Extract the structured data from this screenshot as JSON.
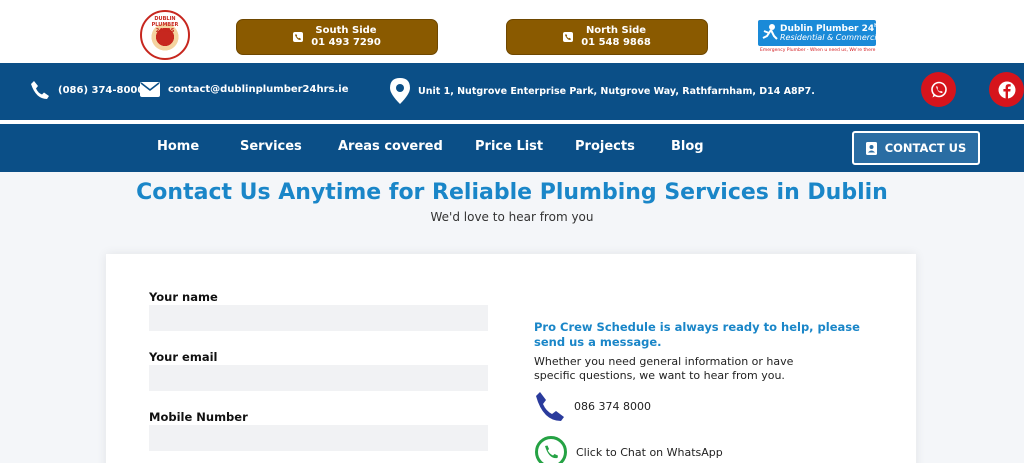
{
  "header": {
    "logo_ring_text": "DUBLIN PLUMBER 24HRS",
    "branches": [
      {
        "name": "South Side",
        "phone": "01 493 7290"
      },
      {
        "name": "North Side",
        "phone": "01 548 9868"
      }
    ],
    "brand": {
      "line1": "Dublin Plumber 24",
      "line1_sup": "hrs",
      "line2": "Residential & Commercial",
      "tagline": "Emergency Plumber - When u need us, We're there"
    }
  },
  "infobar": {
    "phone": "(086) 374-8000",
    "email": "contact@dublinplumber24hrs.ie",
    "address": "Unit 1, Nutgrove Enterprise Park, Nutgrove Way, Rathfarnham, D14 A8P7.",
    "social_icons": [
      "whatsapp-icon",
      "facebook-icon"
    ]
  },
  "nav": {
    "items": [
      "Home",
      "Services",
      "Areas covered",
      "Price List",
      "Projects",
      "Blog"
    ],
    "contact_label": "CONTACT US"
  },
  "page": {
    "title": "Contact Us Anytime for Reliable Plumbing Services in Dublin",
    "subtitle": "We'd love to hear from you"
  },
  "form": {
    "name_label": "Your name",
    "email_label": "Your email",
    "mobile_label": "Mobile Number",
    "name_value": "",
    "email_value": "",
    "mobile_value": ""
  },
  "contact_info": {
    "title": "Pro Crew Schedule is always ready to help, please send us a message.",
    "description": "Whether you need general information or have specific questions, we want to hear from you.",
    "phone": "086 374 8000",
    "whatsapp_label": "Click to Chat on WhatsApp"
  },
  "colors": {
    "primary_blue": "#0b4f87",
    "accent_blue": "#1a86c8",
    "branch_brown": "#8a5a00",
    "social_red": "#d6141c"
  }
}
